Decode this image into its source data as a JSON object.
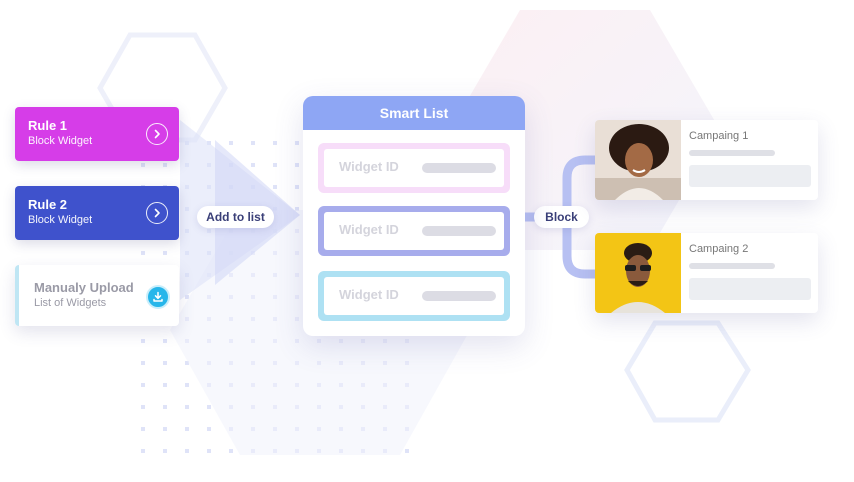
{
  "rules": [
    {
      "title": "Rule 1",
      "subtitle": "Block Widget",
      "color": "#d63de8"
    },
    {
      "title": "Rule 2",
      "subtitle": "Block Widget",
      "color": "#3f52cc"
    }
  ],
  "upload": {
    "title": "Manualy Upload",
    "subtitle": "List of Widgets"
  },
  "connectors": {
    "add": "Add to list",
    "block": "Block"
  },
  "smart_list": {
    "title": "Smart List",
    "header_color": "#8ea6f4",
    "items": [
      {
        "label": "Widget ID",
        "border_color": "#f7ddf9"
      },
      {
        "label": "Widget ID",
        "border_color": "#a7acec"
      },
      {
        "label": "Widget ID",
        "border_color": "#aee1f3"
      }
    ]
  },
  "campaigns": [
    {
      "name": "Campaing 1",
      "photo_bg": "#e9dfd6"
    },
    {
      "name": "Campaing 2",
      "photo_bg": "#f3c515"
    }
  ],
  "icons": {
    "rule_action": "chevron-right-icon",
    "upload_action": "download-icon"
  }
}
